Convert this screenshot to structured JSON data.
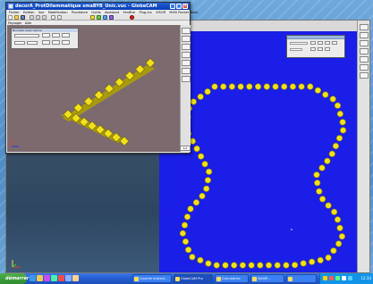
{
  "front_window": {
    "title": "decorA_ProtDilemmatique smaBYB_Unic.vuc - GlobeCAM",
    "menu": [
      "Fichier",
      "Edition",
      "Vue",
      "Modification",
      "Procédure",
      "Outils",
      "Assistant",
      "Fenêtre",
      "Plug-Ins",
      "VISOR",
      "MISS Pocket Tools"
    ],
    "menu2": [
      "Paysager",
      "Aide"
    ],
    "dialog_caption": "Nouvelle (Gen) Spline",
    "minimize": "_",
    "maximize": "□",
    "close": "×",
    "status_box": "1/1"
  },
  "taskbar": {
    "start_label": "démarrer",
    "tasks": [
      {
        "label": "Courrier entrant -"
      },
      {
        "label": "GlobeCAM Pro"
      },
      {
        "label": "Calculatrice"
      },
      {
        "label": "SetViP..."
      },
      {
        "label": ""
      }
    ],
    "clock": "12:34"
  },
  "colors": {
    "blue_view": "#1a1ee6",
    "bead_yellow": "#f2e11a",
    "viewport_bg": "#7c6a6f"
  }
}
